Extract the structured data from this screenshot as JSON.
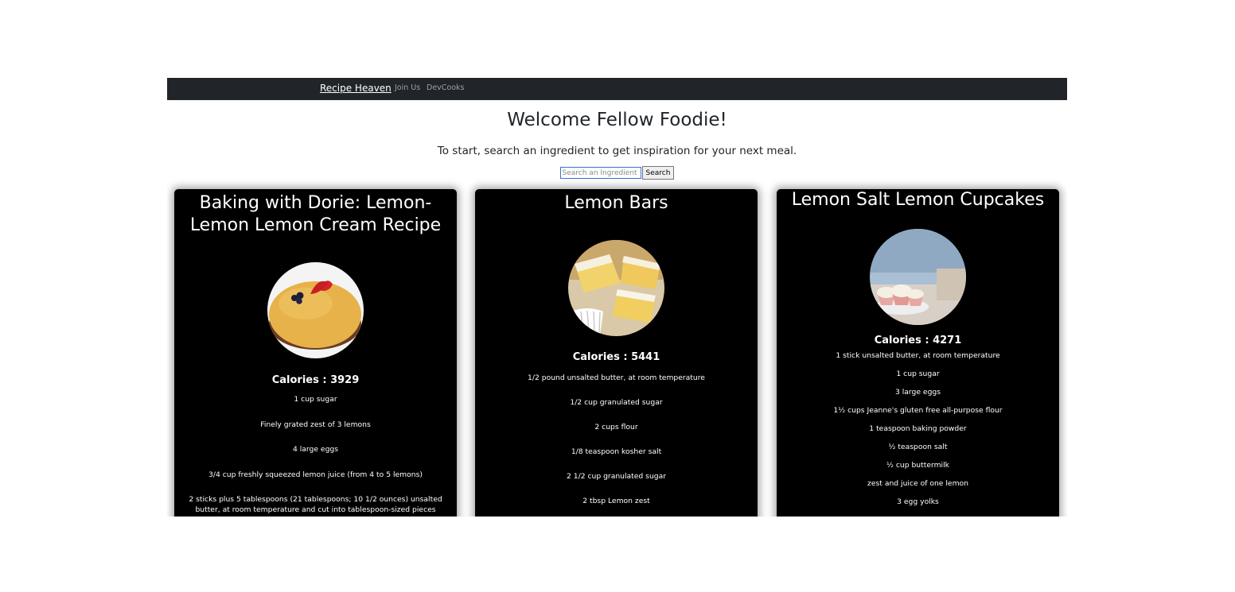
{
  "navbar": {
    "brand": "Recipe Heaven",
    "links": [
      "Join Us",
      "DevCooks"
    ]
  },
  "hero": {
    "title": "Welcome Fellow Foodie!",
    "subtitle": "To start, search an ingredient to get inspiration for your next meal."
  },
  "search": {
    "placeholder": "Search an Ingredient",
    "button_label": "Search"
  },
  "recipes": [
    {
      "title": "Baking with Dorie: Lemon-Lemon Lemon Cream Recipe",
      "calories": "Calories : 3929",
      "image": "lemon-cream-tart-photo",
      "ingredients": [
        "1 cup sugar",
        "Finely grated zest of 3 lemons",
        "4 large eggs",
        "3/4 cup freshly squeezed lemon juice (from 4 to 5 lemons)",
        "2 sticks plus 5 tablespoons (21 tablespoons; 10 1/2 ounces) unsalted butter, at room temperature and cut into tablespoon-sized pieces"
      ]
    },
    {
      "title": "Lemon Bars",
      "calories": "Calories : 5441",
      "image": "lemon-bars-photo",
      "ingredients": [
        "1/2 pound unsalted butter, at room temperature",
        "1/2 cup granulated sugar",
        "2 cups flour",
        "1/8 teaspoon kosher salt",
        "2 1/2 cup granulated sugar",
        "2 tbsp Lemon zest"
      ]
    },
    {
      "title": "Lemon Salt Lemon Cupcakes",
      "calories": "Calories : 4271",
      "image": "lemon-cupcakes-photo",
      "ingredients": [
        "1 stick unsalted butter, at room temperature",
        "1 cup sugar",
        "3 large eggs",
        "1½ cups Jeanne's gluten free all-purpose flour",
        "1 teaspoon baking powder",
        "½ teaspoon salt",
        "½ cup buttermilk",
        "zest and juice of one lemon",
        "3 egg yolks"
      ]
    }
  ]
}
